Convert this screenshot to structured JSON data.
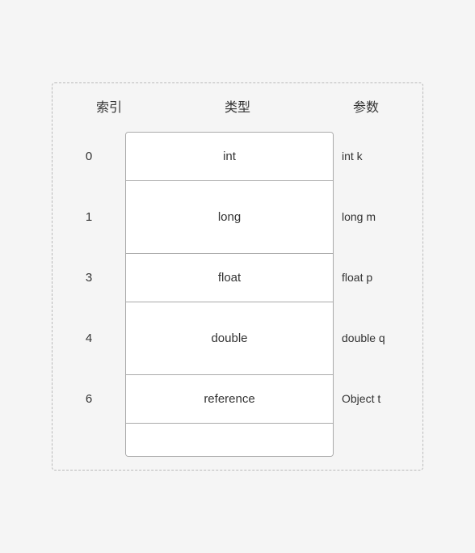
{
  "header": {
    "index_label": "索引",
    "type_label": "类型",
    "param_label": "参数"
  },
  "rows": [
    {
      "index": "0",
      "type": "int",
      "param": "int k",
      "size": "small"
    },
    {
      "index": "1",
      "type": "long",
      "param": "long m",
      "size": "large"
    },
    {
      "index": "3",
      "type": "float",
      "param": "float p",
      "size": "small"
    },
    {
      "index": "4",
      "type": "double",
      "param": "double q",
      "size": "large"
    },
    {
      "index": "6",
      "type": "reference",
      "param": "Object t",
      "size": "small"
    },
    {
      "index": "",
      "type": "",
      "param": "",
      "size": "empty"
    }
  ]
}
